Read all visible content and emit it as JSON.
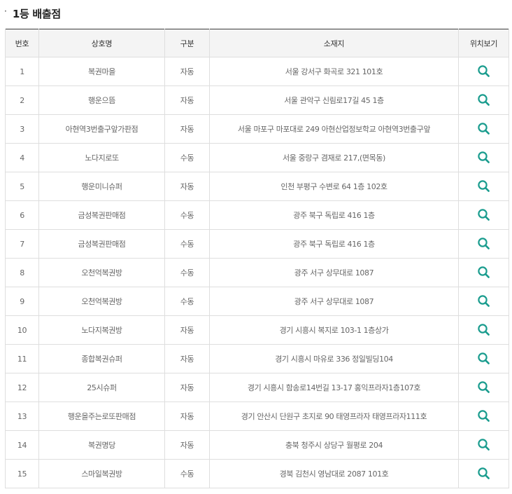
{
  "section": {
    "bullet": "·",
    "title": "1등 배출점"
  },
  "table": {
    "headers": {
      "no": "번호",
      "name": "상호명",
      "type": "구분",
      "address": "소재지",
      "map": "위치보기"
    },
    "rows": [
      {
        "no": "1",
        "name": "복권마을",
        "type": "자동",
        "address": "서울 강서구 화곡로 321 101호"
      },
      {
        "no": "2",
        "name": "행운으뜸",
        "type": "자동",
        "address": "서울 관악구 신림로17길 45 1층"
      },
      {
        "no": "3",
        "name": "아현역3번출구앞가판점",
        "type": "자동",
        "address": "서울 마포구 마포대로 249 아현산업정보학교 아현역3번출구앞"
      },
      {
        "no": "4",
        "name": "노다지로또",
        "type": "수동",
        "address": "서울 중랑구 겸재로 217,(면목동)"
      },
      {
        "no": "5",
        "name": "행운미니슈퍼",
        "type": "자동",
        "address": "인천 부평구 수변로 64 1층 102호"
      },
      {
        "no": "6",
        "name": "금성복권판매점",
        "type": "수동",
        "address": "광주 북구 독립로 416 1층"
      },
      {
        "no": "7",
        "name": "금성복권판매점",
        "type": "수동",
        "address": "광주 북구 독립로 416 1층"
      },
      {
        "no": "8",
        "name": "오천억복권방",
        "type": "수동",
        "address": "광주 서구 상무대로 1087"
      },
      {
        "no": "9",
        "name": "오천억복권방",
        "type": "수동",
        "address": "광주 서구 상무대로 1087"
      },
      {
        "no": "10",
        "name": "노다지복권방",
        "type": "자동",
        "address": "경기 시흥시 복지로 103-1 1층상가"
      },
      {
        "no": "11",
        "name": "종합복권슈퍼",
        "type": "자동",
        "address": "경기 시흥시 마유로 336 정일빌딩104"
      },
      {
        "no": "12",
        "name": "25시슈퍼",
        "type": "자동",
        "address": "경기 시흥시 함송로14번길 13-17 홍익프라자1층107호"
      },
      {
        "no": "13",
        "name": "행운을주는로또판매점",
        "type": "자동",
        "address": "경기 안산시 단원구 초지로 90 태영프라자 태영프라자111호"
      },
      {
        "no": "14",
        "name": "복권명당",
        "type": "자동",
        "address": "충북 청주시 상당구 월평로 204"
      },
      {
        "no": "15",
        "name": "스마일복권방",
        "type": "수동",
        "address": "경북 김천시 영남대로 2087 101호"
      }
    ]
  },
  "icons": {
    "map": "search-icon"
  },
  "colors": {
    "icon": "#1a9c8e",
    "header_bg": "#f4f4f4",
    "border": "#dedede",
    "top_border": "#3d3d3d"
  }
}
